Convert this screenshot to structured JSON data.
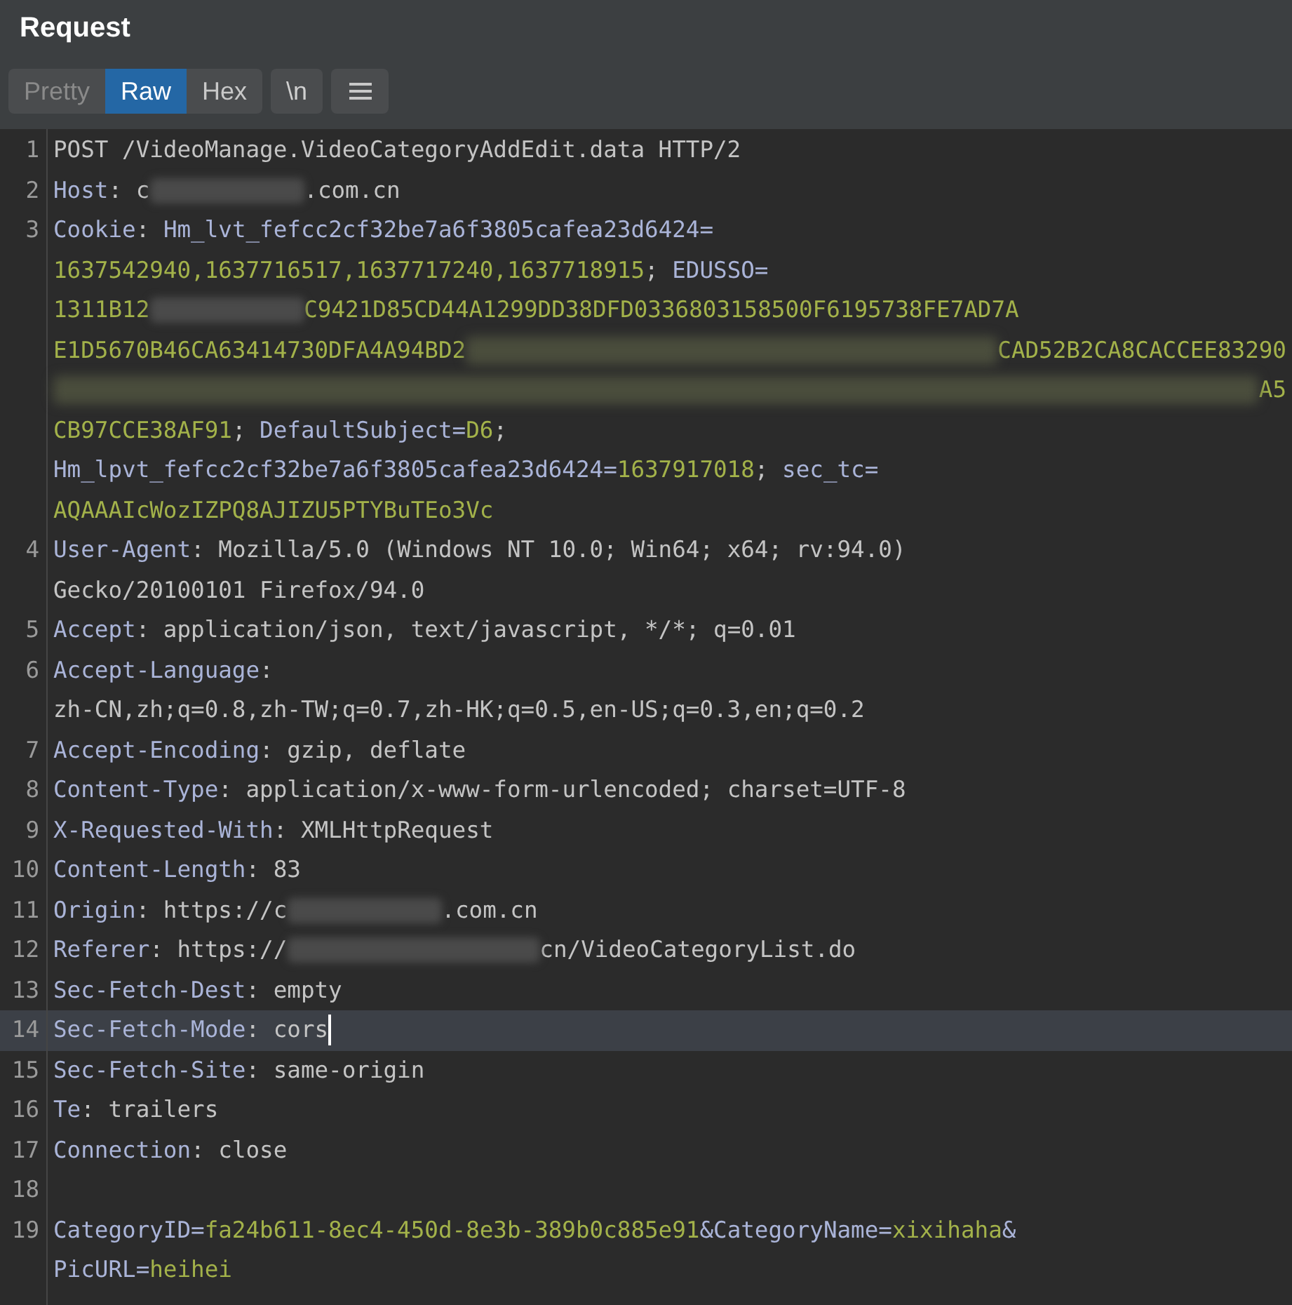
{
  "panel": {
    "title": "Request"
  },
  "tabs": [
    {
      "label": "Pretty",
      "selected": false
    },
    {
      "label": "Raw",
      "selected": true
    },
    {
      "label": "Hex",
      "selected": false
    }
  ],
  "toolbar": {
    "newline_toggle": "\\n"
  },
  "lines": [
    {
      "number": "1",
      "highlighted": false,
      "rows": [
        {
          "segments": [
            {
              "kind": "text",
              "text": "POST /VideoManage.VideoCategoryAddEdit.data HTTP/2"
            }
          ]
        }
      ]
    },
    {
      "number": "2",
      "highlighted": false,
      "rows": [
        {
          "segments": [
            {
              "kind": "name",
              "text": "Host"
            },
            {
              "kind": "text",
              "text": ": c"
            },
            {
              "kind": "redacted"
            },
            {
              "kind": "text",
              "text": ".com.cn"
            }
          ]
        }
      ]
    },
    {
      "number": "3",
      "highlighted": false,
      "rows": [
        {
          "segments": [
            {
              "kind": "name",
              "text": "Cookie"
            },
            {
              "kind": "text",
              "text": ": "
            },
            {
              "kind": "name",
              "text": "Hm_lvt_fefcc2cf32be7a6f3805cafea23d6424="
            }
          ]
        },
        {
          "segments": [
            {
              "kind": "value",
              "text": "1637542940,1637716517,1637717240,1637718915"
            },
            {
              "kind": "text",
              "text": "; "
            },
            {
              "kind": "name",
              "text": "EDUSSO="
            }
          ]
        },
        {
          "segments": [
            {
              "kind": "value",
              "text": "1311B12"
            },
            {
              "kind": "redacted"
            },
            {
              "kind": "value",
              "text": "C9421D85CD44A1299DD38DFD0336803158500F6195738FE7AD7A"
            }
          ]
        },
        {
          "segments": [
            {
              "kind": "value",
              "text": "E1D5670B46CA63414730DFA4A94BD2"
            },
            {
              "kind": "redacted_wide"
            },
            {
              "kind": "value",
              "text": "CAD52B2CA8CACCEE83290"
            }
          ]
        },
        {
          "segments": [
            {
              "kind": "redacted_wide"
            },
            {
              "kind": "value",
              "text": "A5"
            }
          ]
        },
        {
          "segments": [
            {
              "kind": "value",
              "text": "CB97CCE38AF91"
            },
            {
              "kind": "text",
              "text": "; "
            },
            {
              "kind": "name",
              "text": "DefaultSubject="
            },
            {
              "kind": "value",
              "text": "D6"
            },
            {
              "kind": "text",
              "text": ";"
            }
          ]
        },
        {
          "segments": [
            {
              "kind": "name",
              "text": "Hm_lpvt_fefcc2cf32be7a6f3805cafea23d6424="
            },
            {
              "kind": "value",
              "text": "1637917018"
            },
            {
              "kind": "text",
              "text": "; "
            },
            {
              "kind": "name",
              "text": "sec_tc="
            }
          ]
        },
        {
          "segments": [
            {
              "kind": "value",
              "text": "AQAAAIcWozIZPQ8AJIZU5PTYBuTEo3Vc"
            }
          ]
        }
      ]
    },
    {
      "number": "4",
      "highlighted": false,
      "rows": [
        {
          "segments": [
            {
              "kind": "name",
              "text": "User-Agent"
            },
            {
              "kind": "text",
              "text": ": Mozilla/5.0 (Windows NT 10.0; Win64; x64; rv:94.0)"
            }
          ]
        },
        {
          "segments": [
            {
              "kind": "text",
              "text": "Gecko/20100101 Firefox/94.0"
            }
          ]
        }
      ]
    },
    {
      "number": "5",
      "highlighted": false,
      "rows": [
        {
          "segments": [
            {
              "kind": "name",
              "text": "Accept"
            },
            {
              "kind": "text",
              "text": ": application/json, text/javascript, */*; q=0.01"
            }
          ]
        }
      ]
    },
    {
      "number": "6",
      "highlighted": false,
      "rows": [
        {
          "segments": [
            {
              "kind": "name",
              "text": "Accept-Language"
            },
            {
              "kind": "text",
              "text": ":"
            }
          ]
        },
        {
          "segments": [
            {
              "kind": "text",
              "text": "zh-CN,zh;q=0.8,zh-TW;q=0.7,zh-HK;q=0.5,en-US;q=0.3,en;q=0.2"
            }
          ]
        }
      ]
    },
    {
      "number": "7",
      "highlighted": false,
      "rows": [
        {
          "segments": [
            {
              "kind": "name",
              "text": "Accept-Encoding"
            },
            {
              "kind": "text",
              "text": ": gzip, deflate"
            }
          ]
        }
      ]
    },
    {
      "number": "8",
      "highlighted": false,
      "rows": [
        {
          "segments": [
            {
              "kind": "name",
              "text": "Content-Type"
            },
            {
              "kind": "text",
              "text": ": application/x-www-form-urlencoded; charset=UTF-8"
            }
          ]
        }
      ]
    },
    {
      "number": "9",
      "highlighted": false,
      "rows": [
        {
          "segments": [
            {
              "kind": "name",
              "text": "X-Requested-With"
            },
            {
              "kind": "text",
              "text": ": XMLHttpRequest"
            }
          ]
        }
      ]
    },
    {
      "number": "10",
      "highlighted": false,
      "rows": [
        {
          "segments": [
            {
              "kind": "name",
              "text": "Content-Length"
            },
            {
              "kind": "text",
              "text": ": 83"
            }
          ]
        }
      ]
    },
    {
      "number": "11",
      "highlighted": false,
      "rows": [
        {
          "segments": [
            {
              "kind": "name",
              "text": "Origin"
            },
            {
              "kind": "text",
              "text": ": https://c"
            },
            {
              "kind": "redacted"
            },
            {
              "kind": "text",
              "text": ".com.cn"
            }
          ]
        }
      ]
    },
    {
      "number": "12",
      "highlighted": false,
      "rows": [
        {
          "segments": [
            {
              "kind": "name",
              "text": "Referer"
            },
            {
              "kind": "text",
              "text": ": https://"
            },
            {
              "kind": "redacted_long"
            },
            {
              "kind": "text",
              "text": "cn/VideoCategoryList.do"
            }
          ]
        }
      ]
    },
    {
      "number": "13",
      "highlighted": false,
      "rows": [
        {
          "segments": [
            {
              "kind": "name",
              "text": "Sec-Fetch-Dest"
            },
            {
              "kind": "text",
              "text": ": empty"
            }
          ]
        }
      ]
    },
    {
      "number": "14",
      "highlighted": true,
      "caret": true,
      "rows": [
        {
          "segments": [
            {
              "kind": "name",
              "text": "Sec-Fetch-Mode"
            },
            {
              "kind": "text",
              "text": ": cors"
            }
          ]
        }
      ]
    },
    {
      "number": "15",
      "highlighted": false,
      "rows": [
        {
          "segments": [
            {
              "kind": "name",
              "text": "Sec-Fetch-Site"
            },
            {
              "kind": "text",
              "text": ": same-origin"
            }
          ]
        }
      ]
    },
    {
      "number": "16",
      "highlighted": false,
      "rows": [
        {
          "segments": [
            {
              "kind": "name",
              "text": "Te"
            },
            {
              "kind": "text",
              "text": ": trailers"
            }
          ]
        }
      ]
    },
    {
      "number": "17",
      "highlighted": false,
      "rows": [
        {
          "segments": [
            {
              "kind": "name",
              "text": "Connection"
            },
            {
              "kind": "text",
              "text": ": close"
            }
          ]
        }
      ]
    },
    {
      "number": "18",
      "highlighted": false,
      "rows": [
        {
          "segments": []
        }
      ]
    },
    {
      "number": "19",
      "highlighted": false,
      "rows": [
        {
          "segments": [
            {
              "kind": "name",
              "text": "CategoryID="
            },
            {
              "kind": "value",
              "text": "fa24b611-8ec4-450d-8e3b-389b0c885e91"
            },
            {
              "kind": "name",
              "text": "&CategoryName="
            },
            {
              "kind": "value",
              "text": "xixihaha"
            },
            {
              "kind": "name",
              "text": "&"
            }
          ]
        },
        {
          "segments": [
            {
              "kind": "name",
              "text": "PicURL="
            },
            {
              "kind": "value",
              "text": "heihei"
            }
          ]
        }
      ]
    }
  ]
}
